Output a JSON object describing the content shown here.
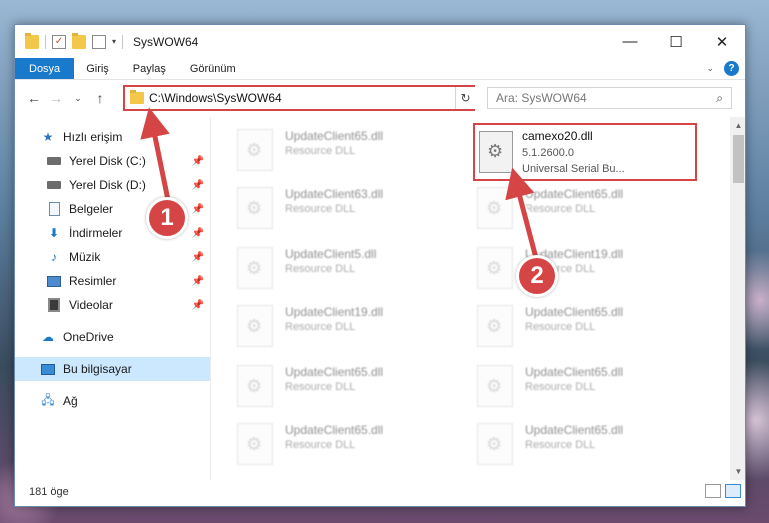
{
  "window": {
    "title": "SysWOW64",
    "minimize_icon": "minimize-icon",
    "maximize_icon": "maximize-icon",
    "close_icon": "close-icon"
  },
  "ribbon": {
    "tabs": [
      "Dosya",
      "Giriş",
      "Paylaş",
      "Görünüm"
    ],
    "help": "?"
  },
  "navbar": {
    "address": "C:\\Windows\\SysWOW64",
    "search_placeholder": "Ara: SysWOW64"
  },
  "sidebar": {
    "items": [
      {
        "label": "Hızlı erişim",
        "icon": "star-icon"
      },
      {
        "label": "Yerel Disk (C:)",
        "icon": "disk-icon",
        "pinned": true
      },
      {
        "label": "Yerel Disk (D:)",
        "icon": "disk-icon",
        "pinned": true
      },
      {
        "label": "Belgeler",
        "icon": "document-icon",
        "pinned": true
      },
      {
        "label": "İndirmeler",
        "icon": "download-icon",
        "pinned": true
      },
      {
        "label": "Müzik",
        "icon": "music-icon",
        "pinned": true
      },
      {
        "label": "Resimler",
        "icon": "pictures-icon",
        "pinned": true
      },
      {
        "label": "Videolar",
        "icon": "videos-icon",
        "pinned": true
      },
      {
        "label": "OneDrive",
        "icon": "cloud-icon"
      },
      {
        "label": "Bu bilgisayar",
        "icon": "computer-icon",
        "selected": true
      },
      {
        "label": "Ağ",
        "icon": "network-icon"
      }
    ]
  },
  "files": {
    "left_column": [
      {
        "name": "UpdateClient65.dll",
        "type": "Resource DLL"
      },
      {
        "name": "UpdateClient63.dll",
        "type": "Resource DLL"
      },
      {
        "name": "UpdateClient5.dll",
        "type": "Resource DLL"
      },
      {
        "name": "UpdateClient19.dll",
        "type": "Resource DLL"
      },
      {
        "name": "UpdateClient65.dll",
        "type": "Resource DLL"
      },
      {
        "name": "UpdateClient65.dll",
        "type": "Resource DLL"
      }
    ],
    "right_column": [
      {
        "name": "UpdateClient65.dll",
        "type": "Resource DLL"
      },
      {
        "name": "UpdateClient19.dll",
        "type": "Resource DLL"
      },
      {
        "name": "UpdateClient65.dll",
        "type": "Resource DLL"
      },
      {
        "name": "UpdateClient65.dll",
        "type": "Resource DLL"
      },
      {
        "name": "UpdateClient65.dll",
        "type": "Resource DLL"
      }
    ],
    "highlighted": {
      "name": "camexo20.dll",
      "version": "5.1.2600.0",
      "description": "Universal Serial Bu..."
    }
  },
  "annotations": {
    "badge1": "1",
    "badge2": "2",
    "color": "#d64545"
  },
  "status": {
    "count": "181 öge"
  }
}
